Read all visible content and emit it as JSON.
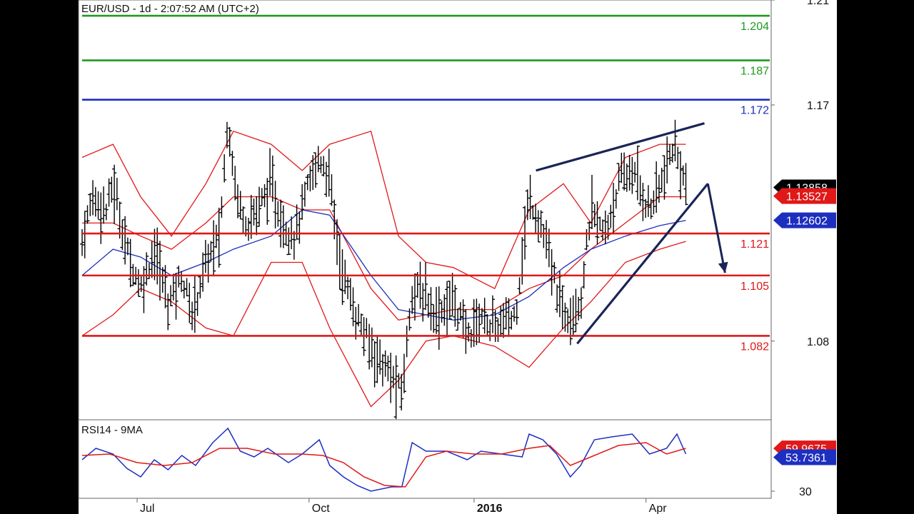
{
  "chart_data": [
    {
      "type": "ohlc",
      "title": "EUR/USD - 1d - 2:07:52 AM (UTC+2)",
      "ylim": [
        1.05,
        1.21
      ],
      "y_ticks": [
        {
          "value": 1.21,
          "label": "1.21"
        },
        {
          "value": 1.17,
          "label": "1.17"
        },
        {
          "value": 1.08,
          "label": "1.08"
        }
      ],
      "x_ticks": [
        {
          "t": 0.08,
          "label": "Jul",
          "bold": false
        },
        {
          "t": 0.33,
          "label": "Oct",
          "bold": false
        },
        {
          "t": 0.57,
          "label": "2016",
          "bold": true
        },
        {
          "t": 0.82,
          "label": "Apr",
          "bold": false
        }
      ],
      "levels": [
        {
          "value": 1.204,
          "label": "1.204",
          "color": "#1f9a1f"
        },
        {
          "value": 1.187,
          "label": "1.187",
          "color": "#1f9a1f"
        },
        {
          "value": 1.172,
          "label": "1.172",
          "color": "#1d2fbf"
        },
        {
          "value": 1.121,
          "label": "1.121",
          "color": "#e01818"
        },
        {
          "value": 1.105,
          "label": "1.105",
          "color": "#e01818"
        },
        {
          "value": 1.082,
          "label": "1.082",
          "color": "#e01818"
        }
      ],
      "price_tags": [
        {
          "label": "1.13858",
          "value": 1.13858,
          "color": "#000000"
        },
        {
          "label": "1.13527",
          "value": 1.13527,
          "color": "#e01818"
        },
        {
          "label": "1.12602",
          "value": 1.12602,
          "color": "#1d2fbf"
        }
      ],
      "price_path": [
        [
          0.0,
          1.118
        ],
        [
          0.015,
          1.135
        ],
        [
          0.035,
          1.13
        ],
        [
          0.045,
          1.14
        ],
        [
          0.065,
          1.115
        ],
        [
          0.085,
          1.1
        ],
        [
          0.105,
          1.115
        ],
        [
          0.125,
          1.095
        ],
        [
          0.145,
          1.105
        ],
        [
          0.16,
          1.09
        ],
        [
          0.18,
          1.11
        ],
        [
          0.2,
          1.12
        ],
        [
          0.212,
          1.165
        ],
        [
          0.225,
          1.135
        ],
        [
          0.24,
          1.125
        ],
        [
          0.255,
          1.13
        ],
        [
          0.275,
          1.14
        ],
        [
          0.29,
          1.125
        ],
        [
          0.31,
          1.12
        ],
        [
          0.33,
          1.14
        ],
        [
          0.345,
          1.15
        ],
        [
          0.36,
          1.142
        ],
        [
          0.375,
          1.11
        ],
        [
          0.395,
          1.092
        ],
        [
          0.415,
          1.08
        ],
        [
          0.44,
          1.07
        ],
        [
          0.465,
          1.06
        ],
        [
          0.48,
          1.1
        ],
        [
          0.5,
          1.097
        ],
        [
          0.515,
          1.09
        ],
        [
          0.54,
          1.096
        ],
        [
          0.56,
          1.082
        ],
        [
          0.58,
          1.09
        ],
        [
          0.6,
          1.085
        ],
        [
          0.63,
          1.09
        ],
        [
          0.65,
          1.135
        ],
        [
          0.67,
          1.122
        ],
        [
          0.685,
          1.105
        ],
        [
          0.7,
          1.09
        ],
        [
          0.725,
          1.095
        ],
        [
          0.74,
          1.13
        ],
        [
          0.76,
          1.12
        ],
        [
          0.78,
          1.14
        ],
        [
          0.8,
          1.145
        ],
        [
          0.825,
          1.13
        ],
        [
          0.85,
          1.145
        ],
        [
          0.86,
          1.155
        ],
        [
          0.878,
          1.14
        ]
      ],
      "bands": {
        "upper": [
          [
            0.0,
            1.15
          ],
          [
            0.045,
            1.155
          ],
          [
            0.085,
            1.135
          ],
          [
            0.13,
            1.12
          ],
          [
            0.18,
            1.14
          ],
          [
            0.22,
            1.16
          ],
          [
            0.275,
            1.155
          ],
          [
            0.32,
            1.145
          ],
          [
            0.36,
            1.155
          ],
          [
            0.42,
            1.16
          ],
          [
            0.46,
            1.12
          ],
          [
            0.5,
            1.11
          ],
          [
            0.54,
            1.108
          ],
          [
            0.6,
            1.1
          ],
          [
            0.65,
            1.13
          ],
          [
            0.7,
            1.14
          ],
          [
            0.74,
            1.125
          ],
          [
            0.79,
            1.15
          ],
          [
            0.84,
            1.155
          ],
          [
            0.878,
            1.155
          ]
        ],
        "middle": [
          [
            0.0,
            1.125
          ],
          [
            0.045,
            1.125
          ],
          [
            0.085,
            1.12
          ],
          [
            0.13,
            1.115
          ],
          [
            0.18,
            1.125
          ],
          [
            0.22,
            1.135
          ],
          [
            0.275,
            1.135
          ],
          [
            0.32,
            1.13
          ],
          [
            0.36,
            1.13
          ],
          [
            0.42,
            1.1
          ],
          [
            0.46,
            1.088
          ],
          [
            0.5,
            1.09
          ],
          [
            0.54,
            1.092
          ],
          [
            0.6,
            1.092
          ],
          [
            0.65,
            1.1
          ],
          [
            0.7,
            1.105
          ],
          [
            0.74,
            1.115
          ],
          [
            0.79,
            1.125
          ],
          [
            0.84,
            1.135
          ],
          [
            0.878,
            1.135
          ]
        ],
        "lower": [
          [
            0.0,
            1.082
          ],
          [
            0.045,
            1.09
          ],
          [
            0.085,
            1.1
          ],
          [
            0.13,
            1.095
          ],
          [
            0.18,
            1.085
          ],
          [
            0.22,
            1.082
          ],
          [
            0.275,
            1.11
          ],
          [
            0.32,
            1.11
          ],
          [
            0.36,
            1.085
          ],
          [
            0.42,
            1.055
          ],
          [
            0.46,
            1.065
          ],
          [
            0.5,
            1.08
          ],
          [
            0.54,
            1.082
          ],
          [
            0.6,
            1.078
          ],
          [
            0.65,
            1.07
          ],
          [
            0.7,
            1.085
          ],
          [
            0.74,
            1.095
          ],
          [
            0.79,
            1.11
          ],
          [
            0.84,
            1.115
          ],
          [
            0.878,
            1.118
          ]
        ],
        "ma": [
          [
            0.0,
            1.105
          ],
          [
            0.045,
            1.115
          ],
          [
            0.085,
            1.112
          ],
          [
            0.13,
            1.105
          ],
          [
            0.18,
            1.11
          ],
          [
            0.22,
            1.115
          ],
          [
            0.275,
            1.12
          ],
          [
            0.32,
            1.13
          ],
          [
            0.36,
            1.128
          ],
          [
            0.42,
            1.105
          ],
          [
            0.46,
            1.092
          ],
          [
            0.5,
            1.09
          ],
          [
            0.54,
            1.088
          ],
          [
            0.6,
            1.09
          ],
          [
            0.65,
            1.097
          ],
          [
            0.7,
            1.108
          ],
          [
            0.74,
            1.115
          ],
          [
            0.79,
            1.12
          ],
          [
            0.84,
            1.124
          ],
          [
            0.878,
            1.126
          ]
        ]
      },
      "trendlines": [
        {
          "t1": 0.66,
          "v1": 1.145,
          "t2": 0.905,
          "v2": 1.163,
          "color": "#1a2457"
        },
        {
          "t1": 0.72,
          "v1": 1.079,
          "t2": 0.91,
          "v2": 1.14,
          "color": "#1a2457"
        }
      ],
      "arrow": {
        "t1": 0.91,
        "v1": 1.14,
        "t2": 0.935,
        "v2": 1.106,
        "color": "#1a2457"
      }
    },
    {
      "type": "line",
      "title": "RSI14 - 9MA",
      "ylim": [
        25,
        80
      ],
      "y_ticks": [
        {
          "value": 30,
          "label": "30"
        }
      ],
      "series": [
        {
          "name": "RSI14",
          "color": "#1d2fbf",
          "points": [
            [
              0.0,
              52
            ],
            [
              0.02,
              60
            ],
            [
              0.045,
              56
            ],
            [
              0.065,
              46
            ],
            [
              0.085,
              40
            ],
            [
              0.105,
              52
            ],
            [
              0.125,
              45
            ],
            [
              0.145,
              55
            ],
            [
              0.165,
              48
            ],
            [
              0.19,
              64
            ],
            [
              0.212,
              74
            ],
            [
              0.23,
              58
            ],
            [
              0.25,
              54
            ],
            [
              0.27,
              60
            ],
            [
              0.3,
              50
            ],
            [
              0.32,
              56
            ],
            [
              0.345,
              66
            ],
            [
              0.36,
              48
            ],
            [
              0.38,
              40
            ],
            [
              0.4,
              34
            ],
            [
              0.42,
              30
            ],
            [
              0.45,
              33
            ],
            [
              0.465,
              33
            ],
            [
              0.48,
              64
            ],
            [
              0.5,
              58
            ],
            [
              0.53,
              58
            ],
            [
              0.56,
              52
            ],
            [
              0.58,
              58
            ],
            [
              0.61,
              56
            ],
            [
              0.64,
              54
            ],
            [
              0.65,
              70
            ],
            [
              0.67,
              66
            ],
            [
              0.69,
              56
            ],
            [
              0.71,
              40
            ],
            [
              0.725,
              48
            ],
            [
              0.745,
              66
            ],
            [
              0.77,
              68
            ],
            [
              0.8,
              70
            ],
            [
              0.825,
              56
            ],
            [
              0.85,
              60
            ],
            [
              0.865,
              70
            ],
            [
              0.878,
              56
            ]
          ]
        },
        {
          "name": "9MA",
          "color": "#e01818",
          "points": [
            [
              0.0,
              55
            ],
            [
              0.04,
              56
            ],
            [
              0.08,
              50
            ],
            [
              0.12,
              48
            ],
            [
              0.16,
              50
            ],
            [
              0.2,
              60
            ],
            [
              0.24,
              60
            ],
            [
              0.28,
              56
            ],
            [
              0.32,
              56
            ],
            [
              0.35,
              55
            ],
            [
              0.38,
              50
            ],
            [
              0.41,
              40
            ],
            [
              0.44,
              34
            ],
            [
              0.47,
              33
            ],
            [
              0.5,
              54
            ],
            [
              0.53,
              58
            ],
            [
              0.57,
              56
            ],
            [
              0.61,
              56
            ],
            [
              0.65,
              60
            ],
            [
              0.68,
              62
            ],
            [
              0.71,
              48
            ],
            [
              0.74,
              54
            ],
            [
              0.78,
              62
            ],
            [
              0.82,
              64
            ],
            [
              0.85,
              56
            ],
            [
              0.878,
              60
            ]
          ]
        }
      ],
      "value_tags": [
        {
          "label": "59.9675",
          "value": 59.9675,
          "color": "#e01818"
        },
        {
          "label": "53.7361",
          "value": 53.7361,
          "color": "#1d2fbf"
        }
      ]
    }
  ]
}
